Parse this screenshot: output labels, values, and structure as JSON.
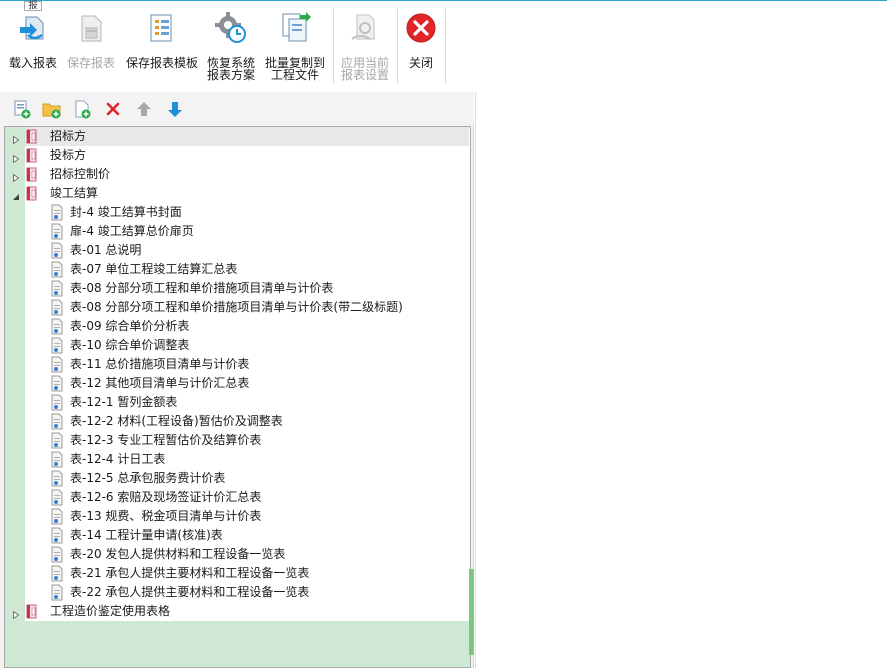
{
  "ribbon": {
    "tooltip": "报",
    "buttons": [
      {
        "id": "load",
        "lines": [
          "载入报表"
        ],
        "disabled": false
      },
      {
        "id": "save",
        "lines": [
          "保存报表"
        ],
        "disabled": true
      },
      {
        "id": "save-template",
        "lines": [
          "保存报表模板"
        ],
        "disabled": false
      },
      {
        "id": "restore",
        "lines": [
          "恢复系统",
          "报表方案"
        ],
        "disabled": false
      },
      {
        "id": "batch-copy",
        "lines": [
          "批量复制到",
          "工程文件"
        ],
        "disabled": false
      },
      {
        "id": "apply",
        "lines": [
          "应用当前",
          "报表设置"
        ],
        "disabled": true
      },
      {
        "id": "close",
        "lines": [
          "关闭"
        ],
        "disabled": false
      }
    ]
  },
  "mini_toolbar": [
    "new-report-icon",
    "new-folder-icon",
    "add-file-icon",
    "delete-icon",
    "move-up-icon",
    "move-down-icon"
  ],
  "tree": {
    "folders": [
      {
        "label": "招标方",
        "expanded": false,
        "selected": true
      },
      {
        "label": "投标方",
        "expanded": false
      },
      {
        "label": "招标控制价",
        "expanded": false
      },
      {
        "label": "竣工结算",
        "expanded": true,
        "children": [
          "封-4 竣工结算书封面",
          "扉-4 竣工结算总价扉页",
          "表-01 总说明",
          "表-07 单位工程竣工结算汇总表",
          "表-08 分部分项工程和单价措施项目清单与计价表",
          "表-08 分部分项工程和单价措施项目清单与计价表(带二级标题)",
          "表-09 综合单价分析表",
          "表-10 综合单价调整表",
          "表-11 总价措施项目清单与计价表",
          "表-12 其他项目清单与计价汇总表",
          "表-12-1 暂列金额表",
          "表-12-2 材料(工程设备)暂估价及调整表",
          "表-12-3 专业工程暂估价及结算价表",
          "表-12-4 计日工表",
          "表-12-5 总承包服务费计价表",
          "表-12-6 索赔及现场签证计价汇总表",
          "表-13 规费、税金项目清单与计价表",
          "表-14 工程计量申请(核准)表",
          "表-20 发包人提供材料和工程设备一览表",
          "表-21 承包人提供主要材料和工程设备一览表",
          "表-22 承包人提供主要材料和工程设备一览表"
        ]
      },
      {
        "label": "工程造价鉴定使用表格",
        "expanded": false
      }
    ]
  },
  "colors": {
    "accent": "#2aa7c9",
    "tree_bg": "#cfe8d4",
    "disabled": "#a6a6a6",
    "close_red": "#e0262b"
  }
}
